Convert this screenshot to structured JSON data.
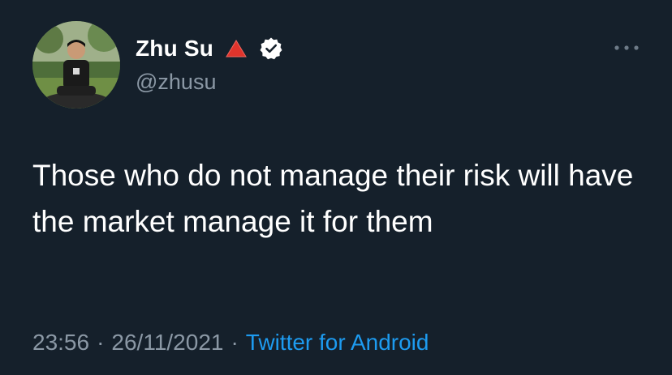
{
  "tweet": {
    "display_name": "Zhu Su",
    "handle": "@zhusu",
    "text": "Those who do not manage their risk will have the market manage it for them",
    "time": "23:56",
    "date": "26/11/2021",
    "separator": "·",
    "source": "Twitter for Android"
  },
  "icons": {
    "name_badge": "red-triangle-icon",
    "verified": "verified-badge-icon",
    "more": "more-options-icon"
  },
  "colors": {
    "background": "#15202b",
    "primary_text": "#ffffff",
    "secondary_text": "#8b98a5",
    "link": "#1d9bf0",
    "triangle": "#e0342c"
  }
}
